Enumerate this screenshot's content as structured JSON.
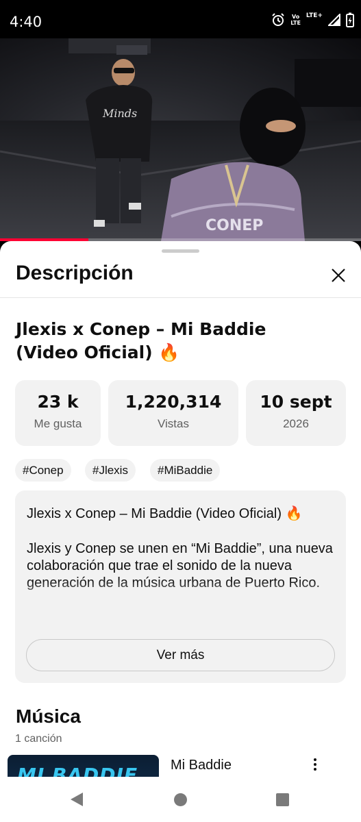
{
  "status_bar": {
    "time": "4:40",
    "volte_top": "Vo",
    "volte_bottom": "LTE",
    "network": "LTE+",
    "icons": [
      "alarm-icon",
      "volte-icon",
      "signal-icon",
      "battery-charging-icon"
    ]
  },
  "video": {
    "progress": 0.245,
    "progress_color": "#ff0033",
    "jacket_text_1": "Minds",
    "jacket_text_2": "CONEP"
  },
  "sheet": {
    "title": "Descripción",
    "close_icon": "close-icon",
    "video_title": "Jlexis x Conep – Mi Baddie (Video Oficial) 🔥",
    "stats": [
      {
        "value": "23 k",
        "label": "Me gusta"
      },
      {
        "value": "1,220,314",
        "label": "Vistas"
      },
      {
        "value": "10 sept",
        "label": "2026"
      }
    ],
    "tags": [
      "#Conep",
      "#Jlexis",
      "#MiBaddie"
    ],
    "description": {
      "line1": "Jlexis x Conep – Mi Baddie (Video Oficial) 🔥",
      "body": "Jlexis y Conep se unen en “Mi Baddie”, una nueva colaboración que trae el sonido de la nueva generación de la música urbana de Puerto Rico.",
      "more_label": "Ver más"
    },
    "music": {
      "title": "Música",
      "subtitle": "1 canción",
      "song_name": "Mi Baddie",
      "thumb_text": "MI BADDIE"
    }
  },
  "nav_bar": {
    "icons": [
      "back-icon",
      "home-icon",
      "recents-icon"
    ]
  },
  "colors": {
    "accent": "#ff0033",
    "chip_bg": "#f2f2f2",
    "text_primary": "#0f0f0f",
    "text_secondary": "#606060"
  }
}
